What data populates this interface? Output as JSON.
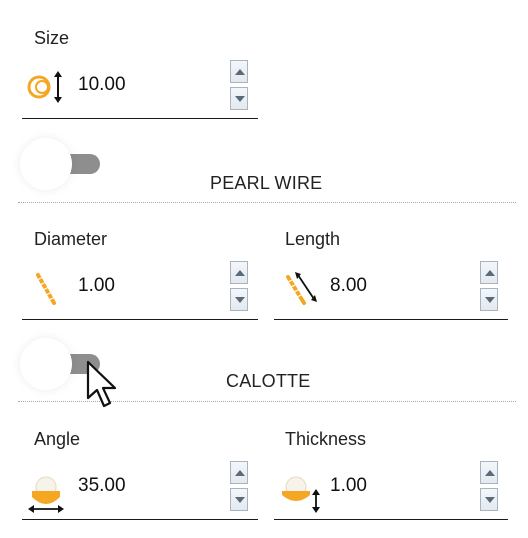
{
  "size": {
    "label": "Size",
    "value": "10.00",
    "icon": "ring-size-icon"
  },
  "pearl_wire": {
    "title": "PEARL WIRE",
    "diameter": {
      "label": "Diameter",
      "value": "1.00",
      "icon": "wire-diameter-icon"
    },
    "length": {
      "label": "Length",
      "value": "8.00",
      "icon": "wire-length-icon"
    }
  },
  "calotte": {
    "title": "CALOTTE",
    "angle": {
      "label": "Angle",
      "value": "35.00",
      "icon": "calotte-angle-icon"
    },
    "thickness": {
      "label": "Thickness",
      "value": "1.00",
      "icon": "calotte-thickness-icon"
    }
  },
  "colors": {
    "accent": "#f5a623",
    "toggle_off": "#8e8e8e"
  },
  "toggles": {
    "pearl_wire_on": false,
    "calotte_on": false
  }
}
